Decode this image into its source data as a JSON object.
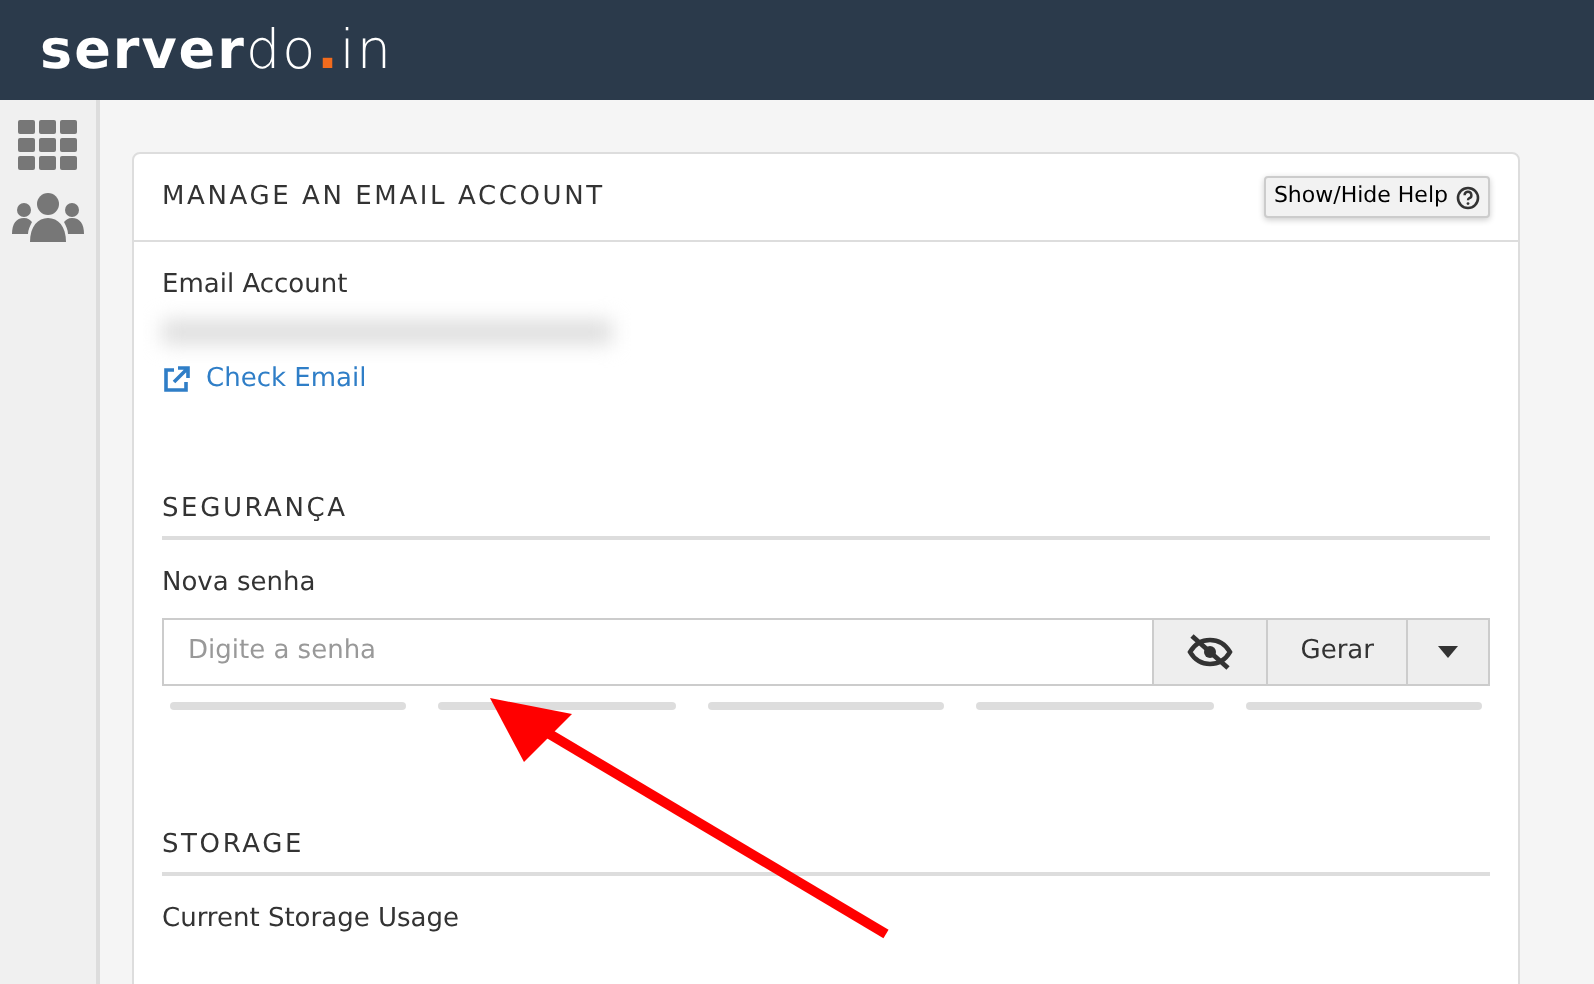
{
  "logo": {
    "parts": [
      {
        "text": "server",
        "kind": "bold"
      },
      {
        "text": "do",
        "kind": "light"
      },
      {
        "text": ".",
        "kind": "dot",
        "color": "#f26b1d"
      },
      {
        "text": "in",
        "kind": "light"
      }
    ]
  },
  "card": {
    "title": "MANAGE AN EMAIL ACCOUNT",
    "help_button": "Show/Hide Help",
    "email_label": "Email Account",
    "check_email": "Check Email",
    "security": {
      "heading": "SEGURANÇA",
      "field_label": "Nova senha",
      "placeholder": "Digite a senha",
      "generate": "Gerar"
    },
    "storage": {
      "heading": "STORAGE",
      "usage_label": "Current Storage Usage"
    }
  }
}
